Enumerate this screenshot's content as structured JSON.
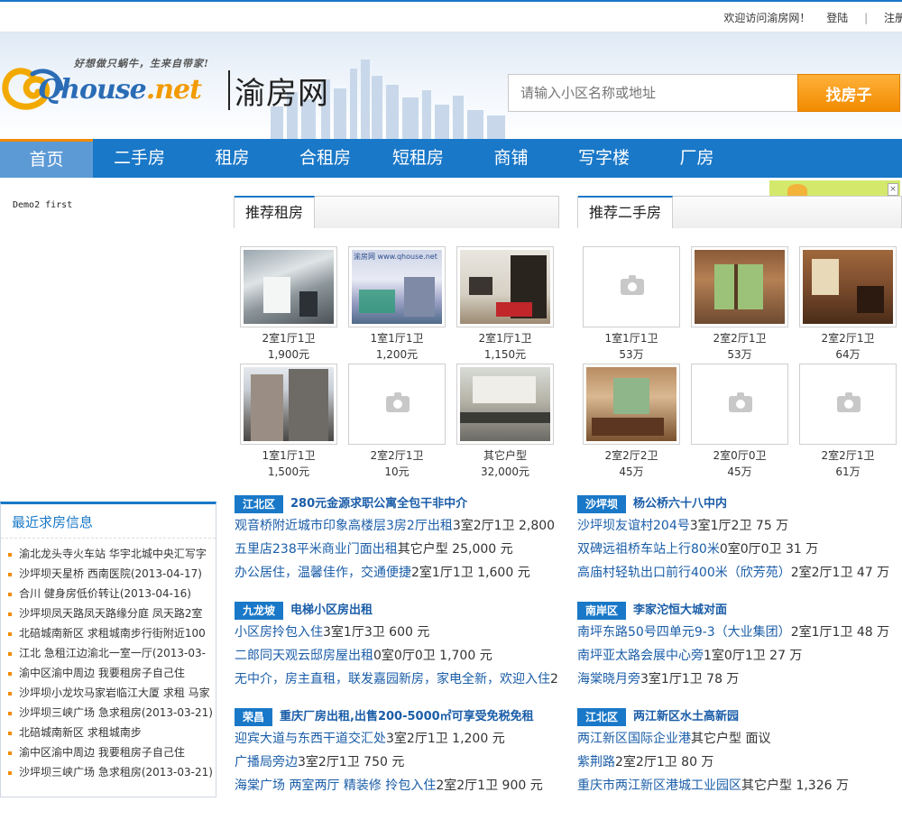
{
  "topbar": {
    "welcome": "欢迎访问渝房网！",
    "login": "登陆",
    "separator": "|",
    "register": "注册"
  },
  "logo": {
    "slogan": "好想做只蜗牛，生来自带家!",
    "brand": "Qhouse",
    "brand_suffix": ".net",
    "brand_cn": "渝房网"
  },
  "search": {
    "placeholder": "请输入小区名称或地址",
    "button": "找房子"
  },
  "nav": {
    "items": [
      "首页",
      "二手房",
      "租房",
      "合租房",
      "短租房",
      "商铺",
      "写字楼",
      "厂房"
    ],
    "active_index": 0
  },
  "left_demo": "Demo2 first",
  "rent": {
    "title": "推荐租房",
    "items": [
      {
        "layout": "2室1厅1卫",
        "price": "1,900元",
        "photo": true
      },
      {
        "layout": "1室1厅1卫",
        "price": "1,200元",
        "photo": true,
        "watermark": "渝房网 www.qhouse.net"
      },
      {
        "layout": "2室1厅1卫",
        "price": "1,150元",
        "photo": true
      },
      {
        "layout": "1室1厅1卫",
        "price": "1,500元",
        "photo": true
      },
      {
        "layout": "2室2厅1卫",
        "price": "10元",
        "photo": false
      },
      {
        "layout": "其它户型",
        "price": "32,000元",
        "photo": true
      }
    ]
  },
  "sale": {
    "title": "推荐二手房",
    "items": [
      {
        "layout": "1室1厅1卫",
        "price": "53万",
        "photo": false
      },
      {
        "layout": "2室2厅1卫",
        "price": "53万",
        "photo": true
      },
      {
        "layout": "2室2厅1卫",
        "price": "64万",
        "photo": true
      },
      {
        "layout": "2室2厅2卫",
        "price": "45万",
        "photo": true
      },
      {
        "layout": "2室0厅0卫",
        "price": "45万",
        "photo": false
      },
      {
        "layout": "2室2厅1卫",
        "price": "61万",
        "photo": false
      }
    ]
  },
  "demand": {
    "title": "最近求房信息",
    "items": [
      "渝北龙头寺火车站 华宇北城中央汇写字",
      "沙坪坝天星桥 西南医院(2013-04-17)",
      "合川 健身房低价转让(2013-04-16)",
      "沙坪坝凤天路凤天路缘分庭 凤天路2室",
      "北碚城南新区 求租城南步行街附近100",
      "江北 急租江边渝北一室一厅(2013-03-",
      "渝中区渝中周边 我要租房子自己住",
      "沙坪坝小龙坎马家岩临江大厦 求租 马家",
      "沙坪坝三峡广场 急求租房(2013-03-21)",
      "北碚城南新区 求租城南步",
      "渝中区渝中周边 我要租房子自己住",
      "沙坪坝三峡广场 急求租房(2013-03-21)"
    ]
  },
  "areas": [
    {
      "badge": "江北区",
      "headline": "280元金源求职公寓全包干非中介",
      "rows": [
        {
          "link": "观音桥附近城市印象高楼层3房2厅出租",
          "info": "3室2厅1卫 2,800"
        },
        {
          "link": "五里店238平米商业门面出租",
          "info": "其它户型 25,000 元"
        },
        {
          "link": "办公居住，温馨佳作，交通便捷",
          "info": "2室1厅1卫 1,600 元"
        }
      ]
    },
    {
      "badge": "沙坪坝",
      "headline": "杨公桥六十八中内",
      "rows": [
        {
          "link": "沙坪坝友谊村204号",
          "info": "3室1厅2卫 75 万"
        },
        {
          "link": "双碑远祖桥车站上行80米",
          "info": "0室0厅0卫 31 万"
        },
        {
          "link": "高庙村轻轨出口前行400米（欣芳苑）",
          "info": "2室2厅1卫 47 万"
        }
      ]
    },
    {
      "badge": "九龙坡",
      "headline": "电梯小区房出租",
      "rows": [
        {
          "link": "小区房拎包入住",
          "info": "3室1厅3卫 600 元"
        },
        {
          "link": "二郎同天观云邸房屋出租",
          "info": "0室0厅0卫 1,700 元"
        },
        {
          "link": "无中介，房主直租，联发嘉园新房，家电全新，欢迎入住",
          "info": "2"
        }
      ]
    },
    {
      "badge": "南岸区",
      "headline": "李家沱恒大城对面",
      "rows": [
        {
          "link": "南坪东路50号四单元9-3（大业集团）",
          "info": "2室1厅1卫 48 万"
        },
        {
          "link": "南坪亚太路会展中心旁",
          "info": "1室0厅1卫 27 万"
        },
        {
          "link": "海棠晓月旁",
          "info": "3室1厅1卫 78 万"
        }
      ]
    },
    {
      "badge": "荣昌",
      "headline": "重庆厂房出租,出售200-5000㎡可享受免税免租",
      "rows": [
        {
          "link": "迎宾大道与东西干道交汇处",
          "info": "3室2厅1卫 1,200 元"
        },
        {
          "link": "广播局旁边",
          "info": "3室2厅1卫 750 元"
        },
        {
          "link": "海棠广场 两室两厅 精装修 拎包入住",
          "info": "2室2厅1卫 900 元"
        }
      ]
    },
    {
      "badge": "江北区",
      "headline": "两江新区水土高新园",
      "rows": [
        {
          "link": "两江新区国际企业港",
          "info": "其它户型 面议"
        },
        {
          "link": "紫荆路",
          "info": "2室2厅1卫 80 万"
        },
        {
          "link": "重庆市两江新区港城工业园区",
          "info": "其它户型 1,326 万"
        }
      ]
    }
  ],
  "colors": {
    "primary": "#1a78c8",
    "accent": "#f28b00",
    "link": "#1a5da8"
  }
}
